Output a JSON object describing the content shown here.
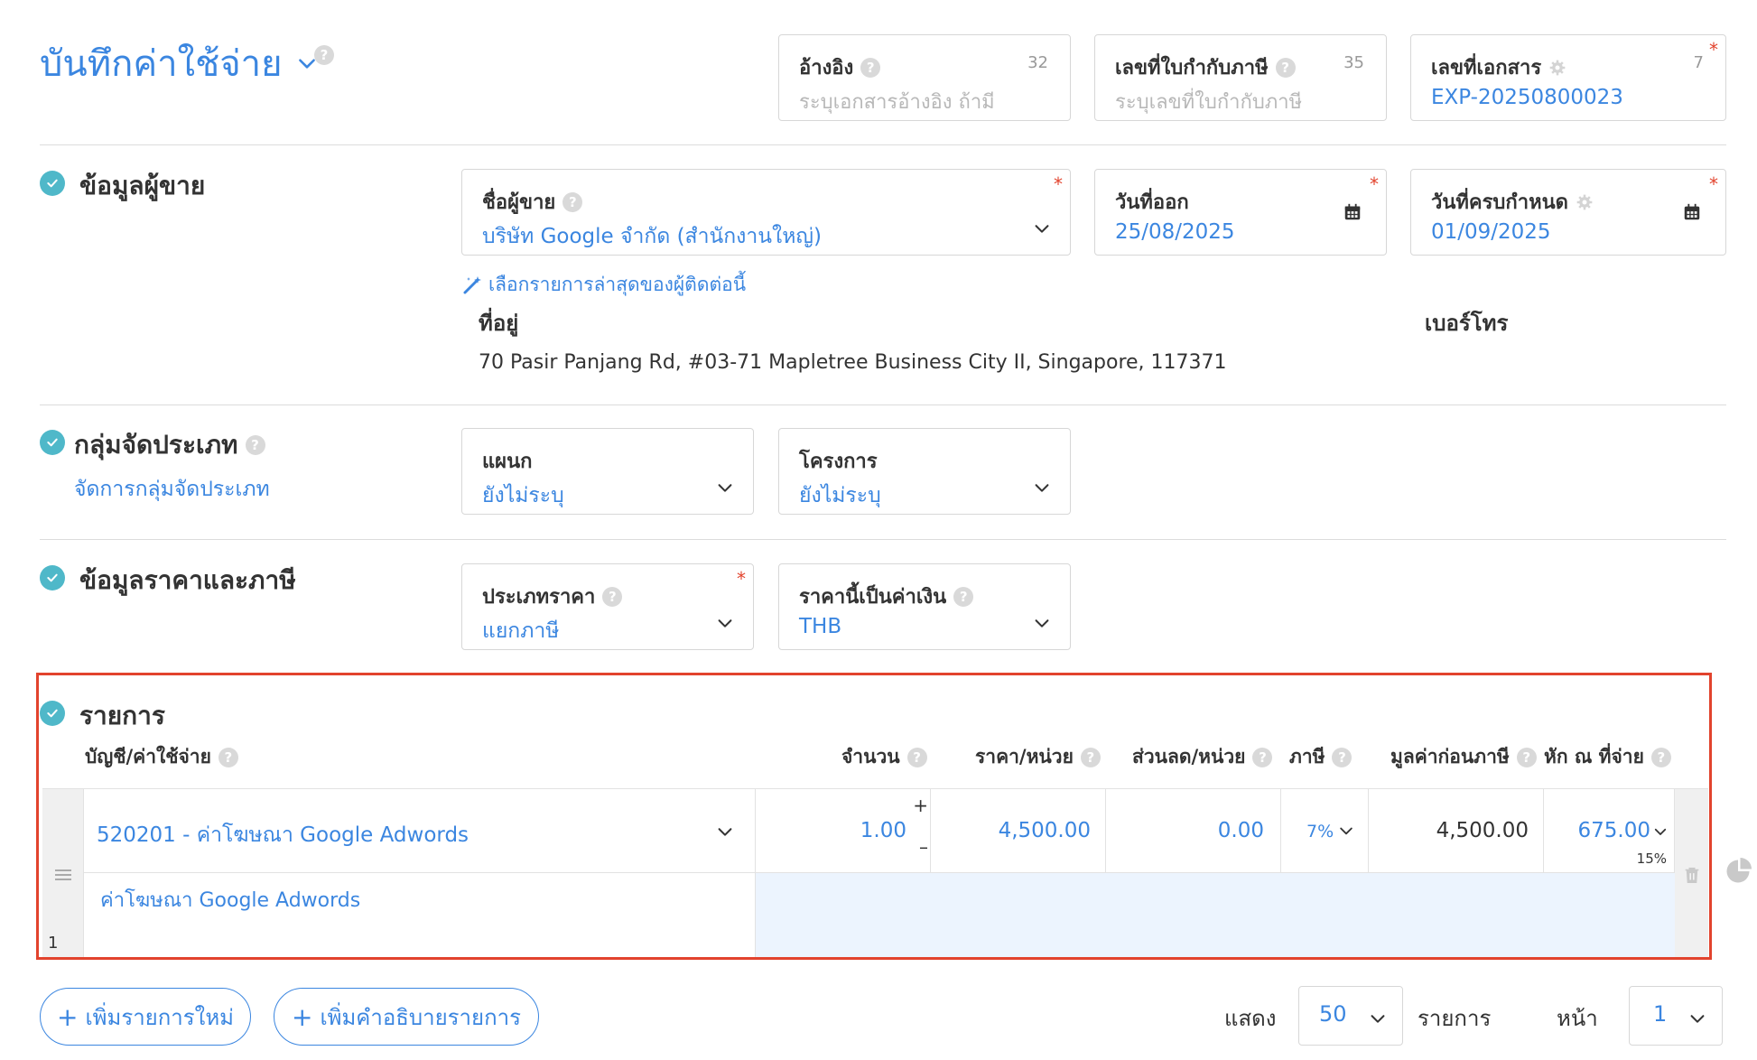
{
  "page": {
    "title": "บันทึกค่าใช้จ่าย"
  },
  "header_fields": {
    "reference": {
      "label": "อ้างอิง",
      "placeholder": "ระบุเอกสารอ้างอิง ถ้ามี",
      "count": "32"
    },
    "tax_invoice": {
      "label": "เลขที่ใบกำกับภาษี",
      "placeholder": "ระบุเลขที่ใบกำกับภาษี",
      "count": "35"
    },
    "doc_number": {
      "label": "เลขที่เอกสาร",
      "value": "EXP-20250800023",
      "count": "7",
      "required": "*"
    }
  },
  "vendor_section": {
    "title": "ข้อมูลผู้ขาย",
    "vendor_name": {
      "label": "ชื่อผู้ขาย",
      "value": "บริษัท Google จำกัด (สำนักงานใหญ่)",
      "required": "*"
    },
    "issue_date": {
      "label": "วันที่ออก",
      "value": "25/08/2025",
      "required": "*"
    },
    "due_date": {
      "label": "วันที่ครบกำหนด",
      "value": "01/09/2025",
      "required": "*"
    },
    "recent_link": "เลือกรายการล่าสุดของผู้ติดต่อนี้",
    "address_label": "ที่อยู่",
    "address_value": "70 Pasir Panjang Rd, #03-71 Mapletree Business City II, Singapore, 117371",
    "phone_label": "เบอร์โทร"
  },
  "category_section": {
    "title": "กลุ่มจัดประเภท",
    "manage_link": "จัดการกลุ่มจัดประเภท",
    "department": {
      "label": "แผนก",
      "value": "ยังไม่ระบุ"
    },
    "project": {
      "label": "โครงการ",
      "value": "ยังไม่ระบุ"
    }
  },
  "price_section": {
    "title": "ข้อมูลราคาและภาษี",
    "price_type": {
      "label": "ประเภทราคา",
      "value": "แยกภาษี",
      "required": "*"
    },
    "currency": {
      "label": "ราคานี้เป็นค่าเงิน",
      "value": "THB"
    }
  },
  "items_section": {
    "title": "รายการ",
    "columns": {
      "account": "บัญชี/ค่าใช้จ่าย",
      "quantity": "จำนวน",
      "unit_price": "ราคา/หน่วย",
      "discount": "ส่วนลด/หน่วย",
      "tax": "ภาษี",
      "pretax": "มูลค่าก่อนภาษี",
      "withholding": "หัก ณ ที่จ่าย"
    },
    "rows": [
      {
        "index": "1",
        "account": "520201 - ค่าโฆษณา Google Adwords",
        "description": "ค่าโฆษณา Google Adwords",
        "quantity": "1.00",
        "unit_price": "4,500.00",
        "discount": "0.00",
        "tax": "7%",
        "pretax": "4,500.00",
        "withholding": "675.00",
        "withholding_rate": "15%"
      }
    ]
  },
  "footer": {
    "add_item": "เพิ่มรายการใหม่",
    "add_description": "เพิ่มคำอธิบายรายการ",
    "show_label": "แสดง",
    "page_size": "50",
    "items_label": "รายการ",
    "page_label": "หน้า",
    "page_number": "1"
  },
  "colors": {
    "accent": "#3b86e0",
    "check": "#4fb8c9",
    "required": "#e2432d",
    "highlight_frame": "#e2432d",
    "row_fill": "#ecf4fe"
  }
}
